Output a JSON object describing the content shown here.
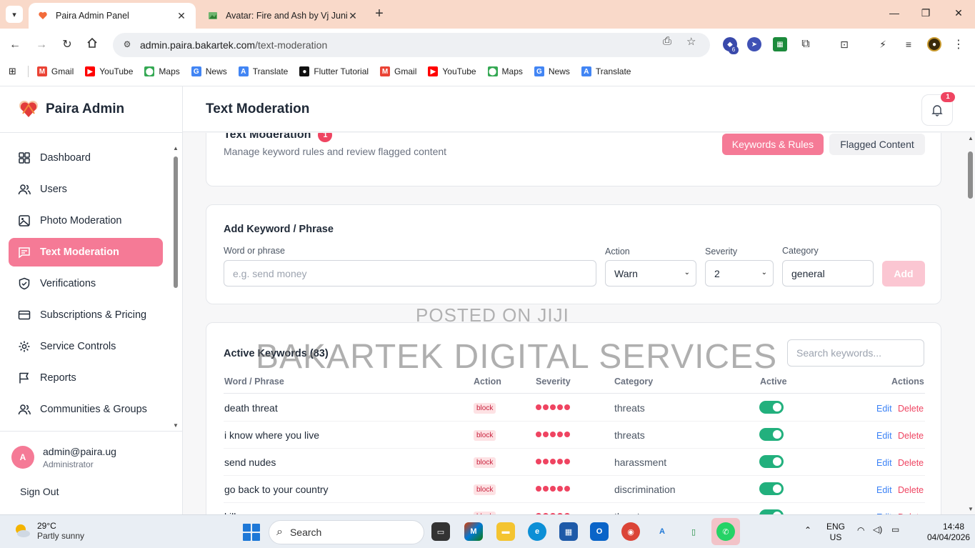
{
  "browser": {
    "tabs": [
      {
        "title": "Paira Admin Panel",
        "active": true
      },
      {
        "title": "Avatar: Fire and Ash by Vj Junio",
        "active": false
      }
    ],
    "url_host": "admin.paira.bakartek.com",
    "url_path": "/text-moderation",
    "extension_badge": "6",
    "bookmarks": [
      {
        "label": "Gmail",
        "icon": "gmail-icon",
        "color": "#ea4335"
      },
      {
        "label": "YouTube",
        "icon": "youtube-icon",
        "color": "#ff0000"
      },
      {
        "label": "Maps",
        "icon": "maps-icon",
        "color": "#34a853"
      },
      {
        "label": "News",
        "icon": "news-icon",
        "color": "#4285f4"
      },
      {
        "label": "Translate",
        "icon": "translate-icon",
        "color": "#4285f4"
      },
      {
        "label": "Flutter Tutorial",
        "icon": "github-icon",
        "color": "#111111"
      },
      {
        "label": "Gmail",
        "icon": "gmail-icon",
        "color": "#ea4335"
      },
      {
        "label": "YouTube",
        "icon": "youtube-icon",
        "color": "#ff0000"
      },
      {
        "label": "Maps",
        "icon": "maps-icon",
        "color": "#34a853"
      },
      {
        "label": "News",
        "icon": "news-icon",
        "color": "#4285f4"
      },
      {
        "label": "Translate",
        "icon": "translate-icon",
        "color": "#4285f4"
      }
    ]
  },
  "sidebar": {
    "brand": "Paira Admin",
    "items": [
      {
        "label": "Dashboard",
        "icon": "grid-icon",
        "key": "dashboard"
      },
      {
        "label": "Users",
        "icon": "users-icon",
        "key": "users"
      },
      {
        "label": "Photo Moderation",
        "icon": "image-icon",
        "key": "photo-moderation"
      },
      {
        "label": "Text Moderation",
        "icon": "message-icon",
        "key": "text-moderation",
        "active": true
      },
      {
        "label": "Verifications",
        "icon": "shield-icon",
        "key": "verifications"
      },
      {
        "label": "Subscriptions & Pricing",
        "icon": "card-icon",
        "key": "subscriptions"
      },
      {
        "label": "Service Controls",
        "icon": "gear-icon",
        "key": "service-controls"
      },
      {
        "label": "Reports",
        "icon": "flag-icon",
        "key": "reports"
      },
      {
        "label": "Communities & Groups",
        "icon": "users-icon",
        "key": "communities"
      }
    ],
    "user": {
      "initial": "A",
      "email": "admin@paira.ug",
      "role": "Administrator"
    },
    "sign_out": "Sign Out"
  },
  "header": {
    "title": "Text Moderation",
    "notifications": "1"
  },
  "moderation": {
    "title": "Text Moderation",
    "badge": "1",
    "subtitle": "Manage keyword rules and review flagged content",
    "tab_rules": "Keywords & Rules",
    "tab_flagged": "Flagged Content"
  },
  "add_form": {
    "title": "Add Keyword / Phrase",
    "word_label": "Word or phrase",
    "word_placeholder": "e.g. send money",
    "action_label": "Action",
    "action_value": "Warn",
    "severity_label": "Severity",
    "severity_value": "2",
    "category_label": "Category",
    "category_value": "general",
    "add_label": "Add"
  },
  "keywords": {
    "title": "Active Keywords (83)",
    "search_placeholder": "Search keywords...",
    "columns": [
      "Word / Phrase",
      "Action",
      "Severity",
      "Category",
      "Active",
      "Actions"
    ],
    "edit_label": "Edit",
    "delete_label": "Delete",
    "rows": [
      {
        "word": "death threat",
        "action": "block",
        "severity": 5,
        "category": "threats",
        "active": true
      },
      {
        "word": "i know where you live",
        "action": "block",
        "severity": 5,
        "category": "threats",
        "active": true
      },
      {
        "word": "send nudes",
        "action": "block",
        "severity": 5,
        "category": "harassment",
        "active": true
      },
      {
        "word": "go back to your country",
        "action": "block",
        "severity": 5,
        "category": "discrimination",
        "active": true
      },
      {
        "word": "kill you",
        "action": "block",
        "severity": 5,
        "category": "threats",
        "active": true
      }
    ]
  },
  "watermark": {
    "line1": "POSTED ON JIJI",
    "line2": "BAKARTEK DIGITAL SERVICES"
  },
  "taskbar": {
    "temp": "29°C",
    "weather": "Partly sunny",
    "search": "Search",
    "lang1": "ENG",
    "lang2": "US",
    "time": "14:48",
    "date": "04/04/2026"
  },
  "colors": {
    "accent": "#f57a96",
    "danger": "#ef4461",
    "success": "#22b07d",
    "link": "#3b82f6"
  }
}
